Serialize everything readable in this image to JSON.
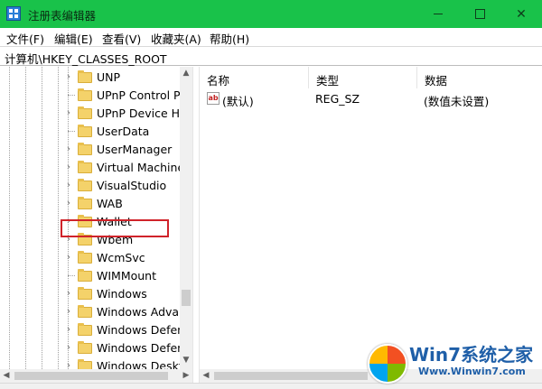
{
  "window": {
    "title": "注册表编辑器"
  },
  "menu": [
    "文件(F)",
    "编辑(E)",
    "查看(V)",
    "收藏夹(A)",
    "帮助(H)"
  ],
  "address": "计算机\\HKEY_CLASSES_ROOT",
  "tree": {
    "items": [
      {
        "label": "UNP",
        "expandable": true
      },
      {
        "label": "UPnP Control Po",
        "expandable": false
      },
      {
        "label": "UPnP Device Ho",
        "expandable": true
      },
      {
        "label": "UserData",
        "expandable": false
      },
      {
        "label": "UserManager",
        "expandable": true
      },
      {
        "label": "Virtual Machine",
        "expandable": true
      },
      {
        "label": "VisualStudio",
        "expandable": true
      },
      {
        "label": "WAB",
        "expandable": true
      },
      {
        "label": "Wallet",
        "expandable": true
      },
      {
        "label": "Wbem",
        "expandable": true
      },
      {
        "label": "WcmSvc",
        "expandable": true
      },
      {
        "label": "WIMMount",
        "expandable": false
      },
      {
        "label": "Windows",
        "expandable": true,
        "highlighted": true
      },
      {
        "label": "Windows Advar",
        "expandable": true
      },
      {
        "label": "Windows Defen",
        "expandable": true
      },
      {
        "label": "Windows Defen",
        "expandable": true
      },
      {
        "label": "Windows Deskt",
        "expandable": true
      }
    ]
  },
  "list": {
    "columns": [
      "名称",
      "类型",
      "数据"
    ],
    "rows": [
      {
        "icon": "string-value-icon",
        "name": "(默认)",
        "type": "REG_SZ",
        "data": "(数值未设置)"
      }
    ]
  },
  "watermark": {
    "brand": "Win7系统之家",
    "url": "Www.Winwin7.com"
  },
  "colors": {
    "titlebar": "#19c24a",
    "highlight_border": "#d0232a",
    "folder": "#f4d26a"
  }
}
